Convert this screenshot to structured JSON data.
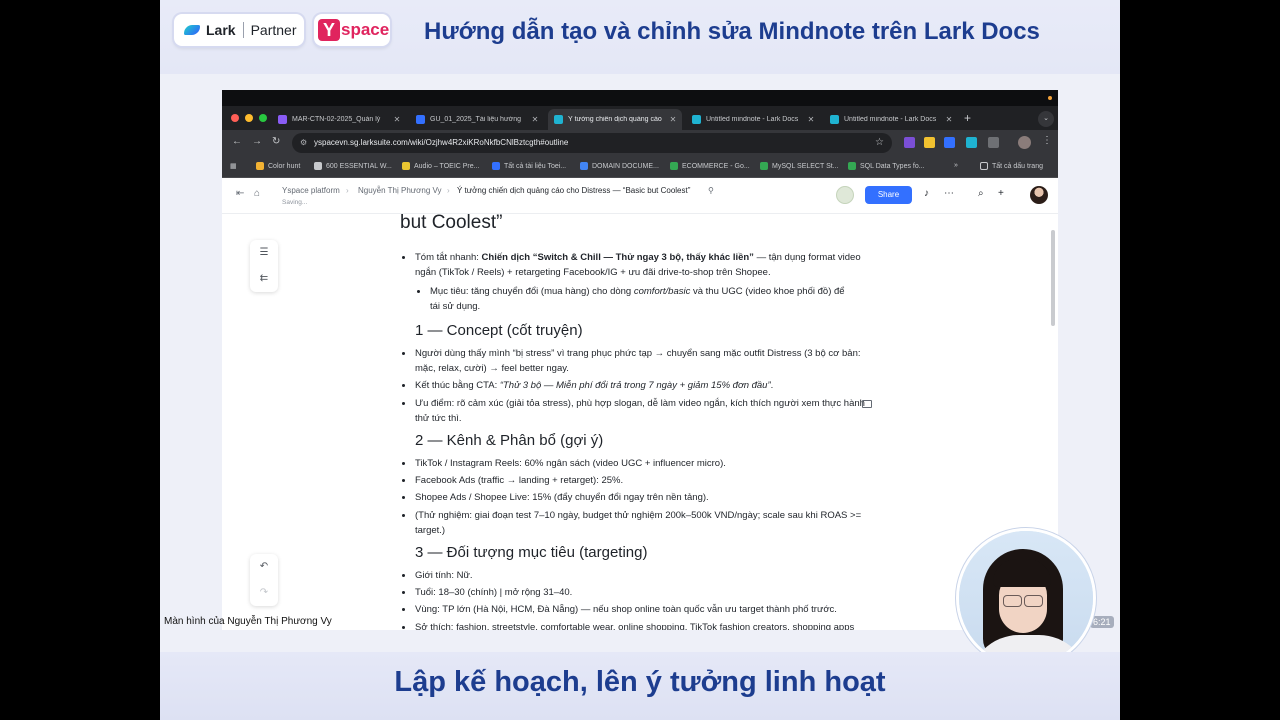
{
  "banner": {
    "lark_logo": "Lark",
    "partner_label": "Partner",
    "yspace_logo_y": "Y",
    "yspace_logo_rest": "space",
    "title": "Hướng dẫn tạo và chỉnh sửa Mindnote trên Lark Docs"
  },
  "caption": "Lập kế hoạch, lên ý tưởng linh hoạt",
  "browser": {
    "tabs": [
      {
        "title": "MAR-CTN-02-2025_Quản lý",
        "icon_color": "#8a5cf5",
        "active": false
      },
      {
        "title": "GU_01_2025_Tài liệu hướng",
        "icon_color": "#3370ff",
        "active": false
      },
      {
        "title": "Ý tưởng chiến dịch quảng cáo",
        "icon_color": "#1fb3d1",
        "active": true
      },
      {
        "title": "Untitled mindnote - Lark Docs",
        "icon_color": "#1fb3d1",
        "active": false
      },
      {
        "title": "Untitled mindnote - Lark Docs",
        "icon_color": "#1fb3d1",
        "active": false
      }
    ],
    "url": "yspacevn.sg.larksuite.com/wiki/Ozjhw4R2xiKRoNkfbCNlBztcgth#outline",
    "bookmarks": [
      {
        "label": "Color hunt",
        "icon_color": "#f2b233"
      },
      {
        "label": "600 ESSENTIAL W...",
        "icon_color": "#c7c9cc"
      },
      {
        "label": "Audio – TOEIC Pre...",
        "icon_color": "#e9c531"
      },
      {
        "label": "Tất cả tài liệu Toei...",
        "icon_color": "#3370ff"
      },
      {
        "label": "DOMAIN DOCUME...",
        "icon_color": "#4285f4"
      },
      {
        "label": "ECOMMERCE - Go...",
        "icon_color": "#34a853"
      },
      {
        "label": "MySQL SELECT St...",
        "icon_color": "#34a853"
      },
      {
        "label": "SQL Data Types fo...",
        "icon_color": "#34a853"
      }
    ],
    "bookmarks_overflow": "»",
    "all_bookmarks": "Tất cả dấu trang"
  },
  "docbar": {
    "crumbs": [
      "Yspace platform",
      "Nguyễn Thị Phương Vy",
      "Ý tưởng chiến dịch quảng cáo cho Distress — “Basic but Coolest”"
    ],
    "saving": "Saving...",
    "share": "Share"
  },
  "doc": {
    "title_tail": "but Coolest”",
    "summary_prefix": "Tóm tắt nhanh: ",
    "summary_bold": "Chiến dịch “Switch & Chill — Thử ngay 3 bộ, thấy khác liền”",
    "summary_rest_1": " — tận dụng format video",
    "summary_rest_2": "ngắn (TikTok / Reels) + retargeting Facebook/IG + ưu đãi drive-to-shop trên Shopee.",
    "goal_1a": "Mục tiêu: tăng chuyển đổi (mua hàng) cho dòng ",
    "goal_1b": "comfort/basic",
    "goal_1c": " và thu UGC (video khoe phối đồ) để",
    "goal_2": "tái sử dụng.",
    "h_concept": "1 — Concept (cốt truyện)",
    "c1_1": "Người dùng thấy mình “bị stress” vì trang phục phức tạp → chuyển sang mặc outfit Distress (3 bộ cơ bản:",
    "c1_2": "mặc, relax, cười) → feel better ngay.",
    "c2a": "Kết thúc bằng CTA: ",
    "c2b": "“Thử 3 bộ — Miễn phí đổi trả trong 7 ngày + giảm 15% đơn đầu”",
    "c2c": ".",
    "c3_1": "Ưu điểm: rõ cảm xúc (giải tỏa stress), phù hợp slogan, dễ làm video ngắn, kích thích người xem thực hành",
    "c3_2": "thử tức thì.",
    "h_channel": "2 — Kênh & Phân bổ (gợi ý)",
    "k1": "TikTok / Instagram Reels: 60% ngân sách (video UGC + influencer micro).",
    "k2": "Facebook Ads (traffic → landing + retarget): 25%.",
    "k3": "Shopee Ads / Shopee Live: 15% (đẩy chuyển đổi ngay trên nền tảng).",
    "k4_1": "(Thử nghiệm: giai đoạn test 7–10 ngày, budget thử nghiệm 200k–500k VND/ngày; scale sau khi ROAS >=",
    "k4_2": "target.)",
    "h_target": "3 — Đối tượng mục tiêu (targeting)",
    "t1": "Giới tính: Nữ.",
    "t2": "Tuổi: 18–30 (chính) | mở rộng 31–40.",
    "t3": "Vùng: TP lớn (Hà Nội, HCM, Đà Nẵng) — nếu shop online toàn quốc vẫn ưu target thành phố trước.",
    "t4": "Sở thích: fashion, streetstyle, comfortable wear, online shopping, TikTok fashion creators, shopping apps"
  },
  "presenter_label": "Màn hình của Nguyễn Thị Phương Vy",
  "timestamp": "6:21"
}
